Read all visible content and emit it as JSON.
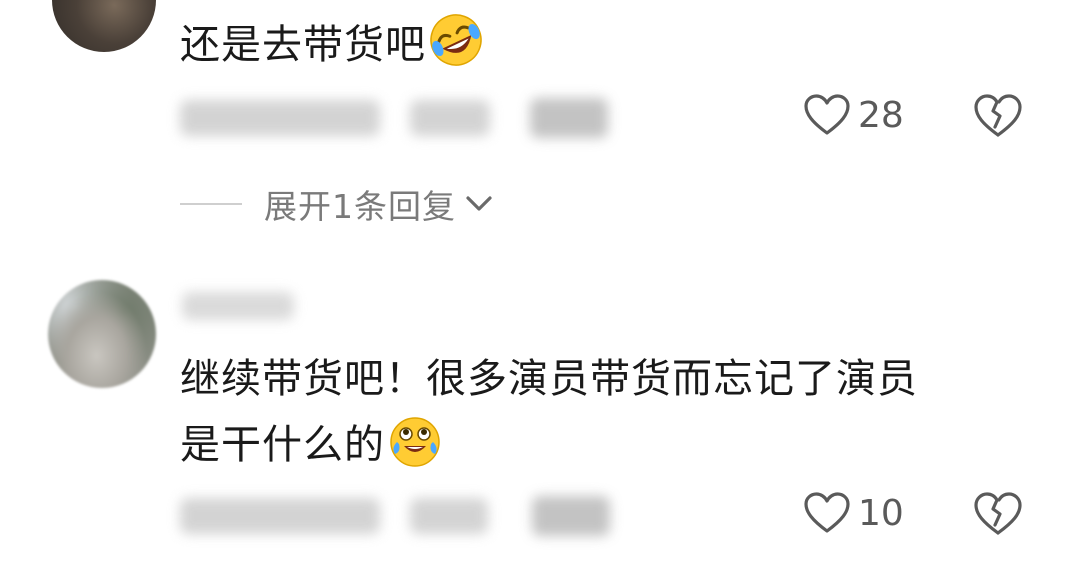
{
  "comments": [
    {
      "text": "还是去带货吧",
      "emoji": "rolling-on-floor-laughing",
      "likes": "28"
    },
    {
      "text_line1": "继续带货吧！很多演员带货而忘记了演员",
      "text_line2": "是干什么的",
      "emoji": "joy-tears",
      "likes": "10"
    }
  ],
  "replies": {
    "expand_label": "展开1条回复"
  },
  "colors": {
    "text": "#1a1a1a",
    "muted": "#7a7a7a",
    "icon": "#5a5a5a"
  }
}
